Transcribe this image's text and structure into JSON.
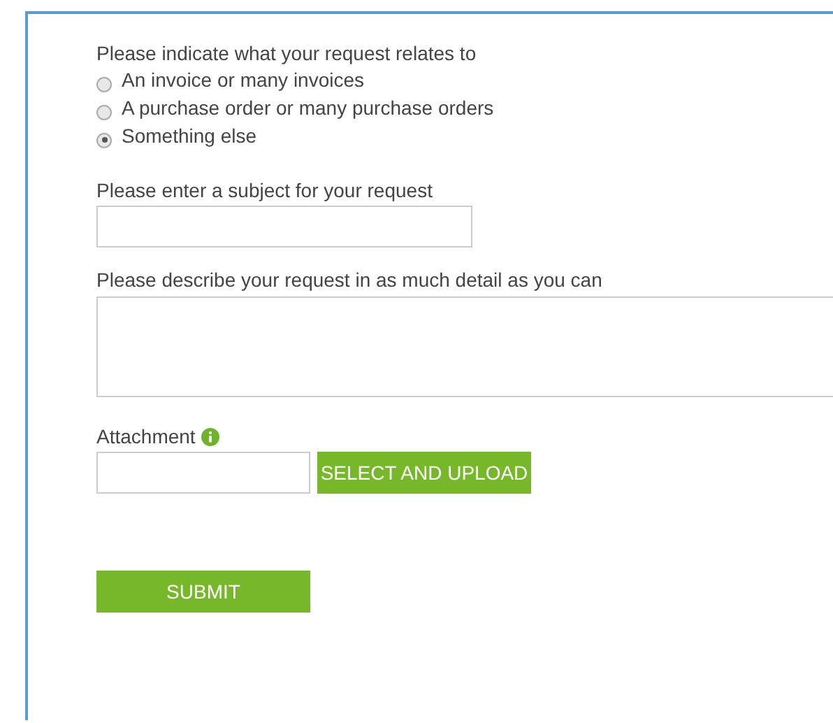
{
  "relates_to": {
    "label": "Please indicate what your request relates to",
    "options": [
      {
        "label": "An invoice or many invoices",
        "selected": false
      },
      {
        "label": "A purchase order or many purchase orders",
        "selected": false
      },
      {
        "label": "Something else",
        "selected": true
      }
    ]
  },
  "subject": {
    "label": "Please enter a subject for your request"
  },
  "description": {
    "label": "Please describe your request in as much detail as you can"
  },
  "attachment": {
    "label": "Attachment",
    "button": "SELECT AND UPLOAD"
  },
  "submit": "SUBMIT"
}
